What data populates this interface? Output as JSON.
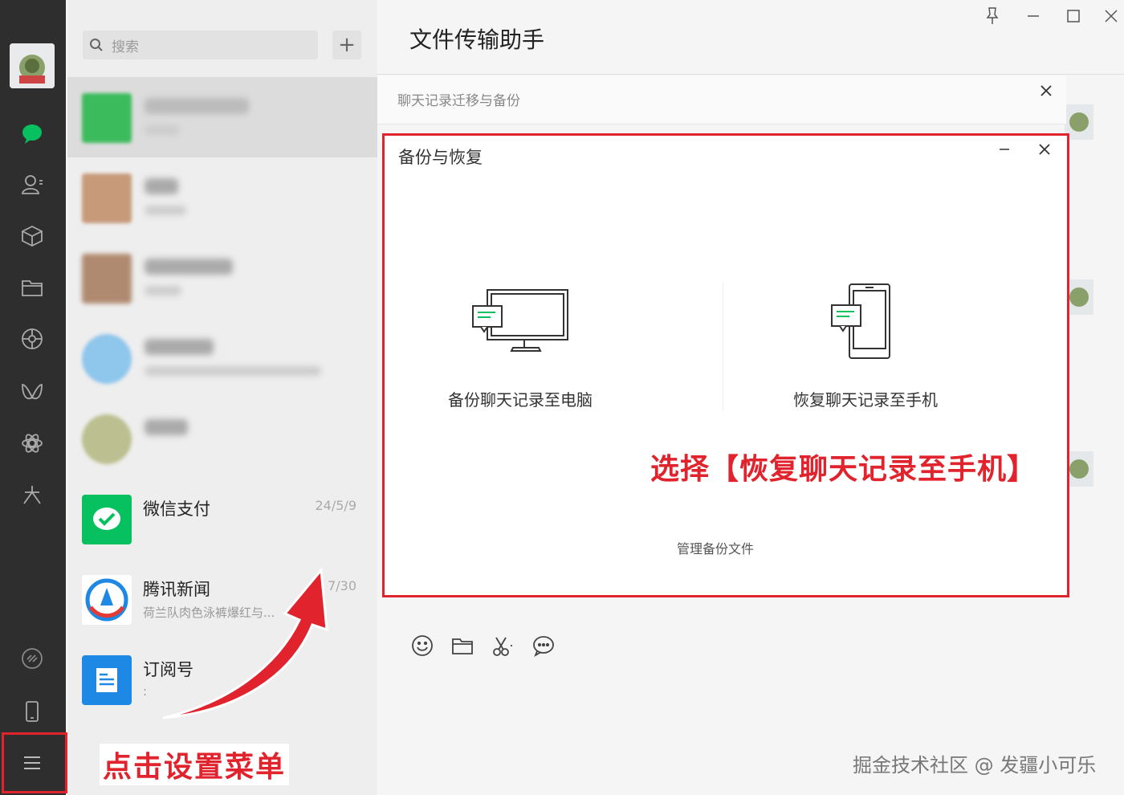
{
  "sidebar": {
    "icons": [
      "chat-icon",
      "contacts-icon",
      "favorites-icon",
      "files-icon",
      "moments-icon",
      "channels-icon",
      "mini-programs-icon",
      "search-web-icon",
      "link-icon",
      "phone-icon",
      "menu-icon"
    ]
  },
  "list": {
    "search_placeholder": "搜索",
    "add_label": "+",
    "chats": [
      {
        "name": "",
        "time": "",
        "preview": "",
        "blurred": true
      },
      {
        "name": "",
        "time": "",
        "preview": "",
        "blurred": true
      },
      {
        "name": "",
        "time": "",
        "preview": "",
        "blurred": true
      },
      {
        "name": "",
        "time": "",
        "preview": "",
        "blurred": true
      },
      {
        "name": "",
        "time": "",
        "preview": "",
        "blurred": true
      },
      {
        "name": "微信支付",
        "time": "24/5/9",
        "preview": ""
      },
      {
        "name": "腾讯新闻",
        "time": "7/30",
        "preview": "荷兰队肉色泳裤爆红与..."
      },
      {
        "name": "订阅号",
        "time": "",
        "preview": ":"
      }
    ]
  },
  "main": {
    "title": "文件传输助手"
  },
  "outer_dialog": {
    "title": "聊天记录迁移与备份"
  },
  "inner_dialog": {
    "title": "备份与恢复",
    "option_backup": "备份聊天记录至电脑",
    "option_restore": "恢复聊天记录至手机",
    "manage_link": "管理备份文件"
  },
  "annotations": {
    "restore_hint": "选择【恢复聊天记录至手机】",
    "menu_hint": "点击设置菜单"
  },
  "watermark": "掘金技术社区 @ 发疆小可乐",
  "colors": {
    "accent_green": "#07c160",
    "annotation_red": "#e0232d",
    "sidebar_bg": "#2e2e2e"
  }
}
